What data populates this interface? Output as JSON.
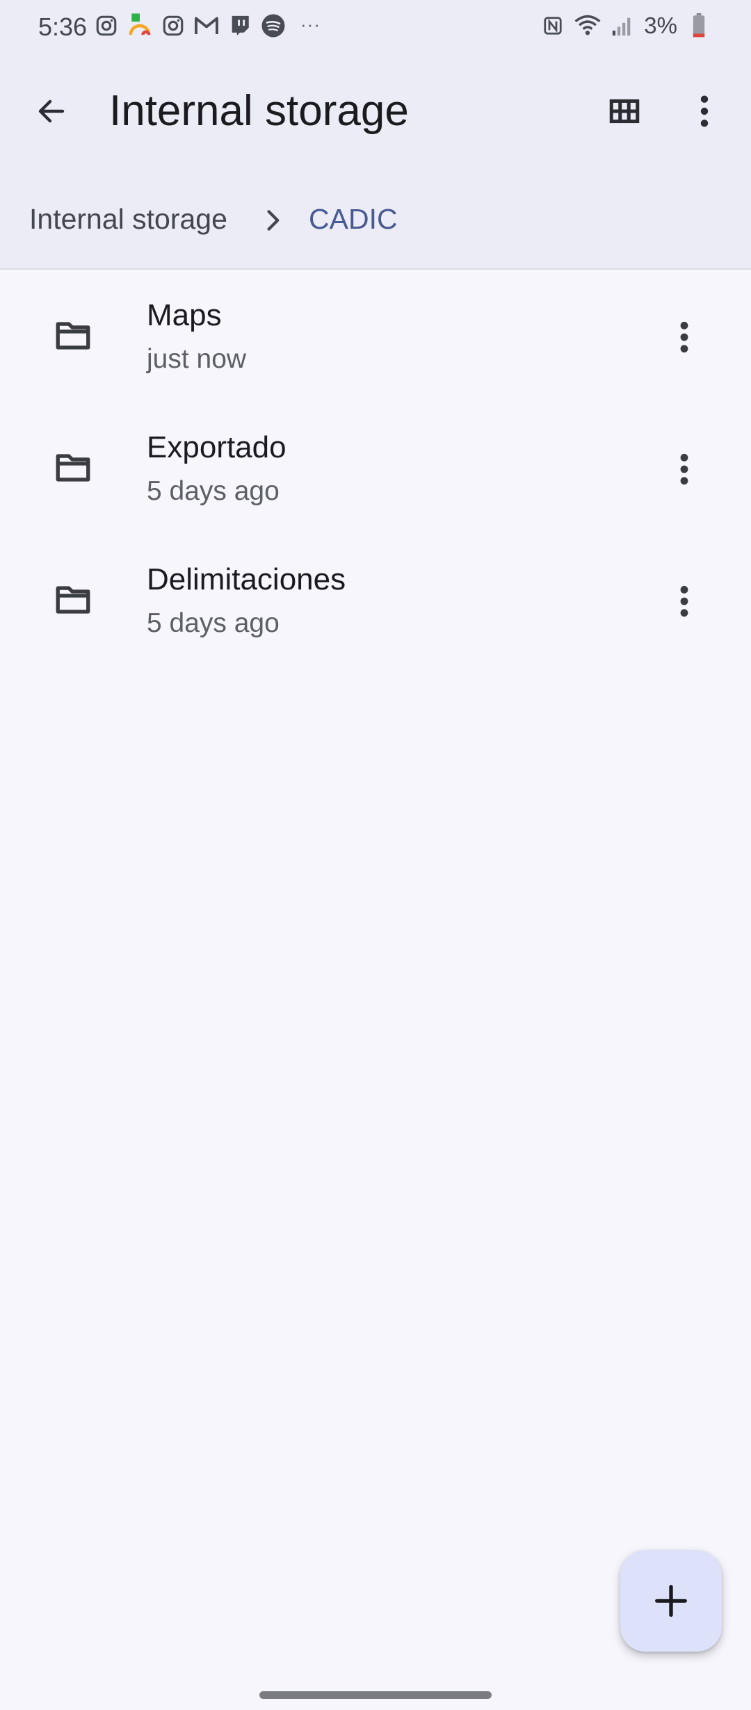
{
  "status_bar": {
    "time": "5:36",
    "left_icons": [
      "instagram-icon",
      "td-app-icon",
      "instagram-icon",
      "gmail-icon",
      "twitch-icon",
      "spotify-icon"
    ],
    "more_indicator": "···",
    "right_icons": [
      "nfc-icon",
      "wifi-icon",
      "signal-icon",
      "battery-icon"
    ],
    "battery_text": "3%"
  },
  "app_bar": {
    "title": "Internal storage",
    "back_icon": "arrow-back-icon",
    "grid_icon": "grid-view-icon",
    "more_icon": "more-vert-icon"
  },
  "breadcrumb": {
    "items": [
      "Internal storage",
      "CADIC"
    ],
    "separator_icon": "chevron-right-icon"
  },
  "files": [
    {
      "name": "Maps",
      "modified": "just now"
    },
    {
      "name": "Exportado",
      "modified": "5 days ago"
    },
    {
      "name": "Delimitaciones",
      "modified": "5 days ago"
    }
  ],
  "fab": {
    "icon": "add-icon"
  },
  "colors": {
    "header_bg": "#ebecf6",
    "body_bg": "#f7f6fd",
    "accent_text": "#485a91",
    "fab_bg": "#dde2fa",
    "battery_low": "#e0453c"
  }
}
